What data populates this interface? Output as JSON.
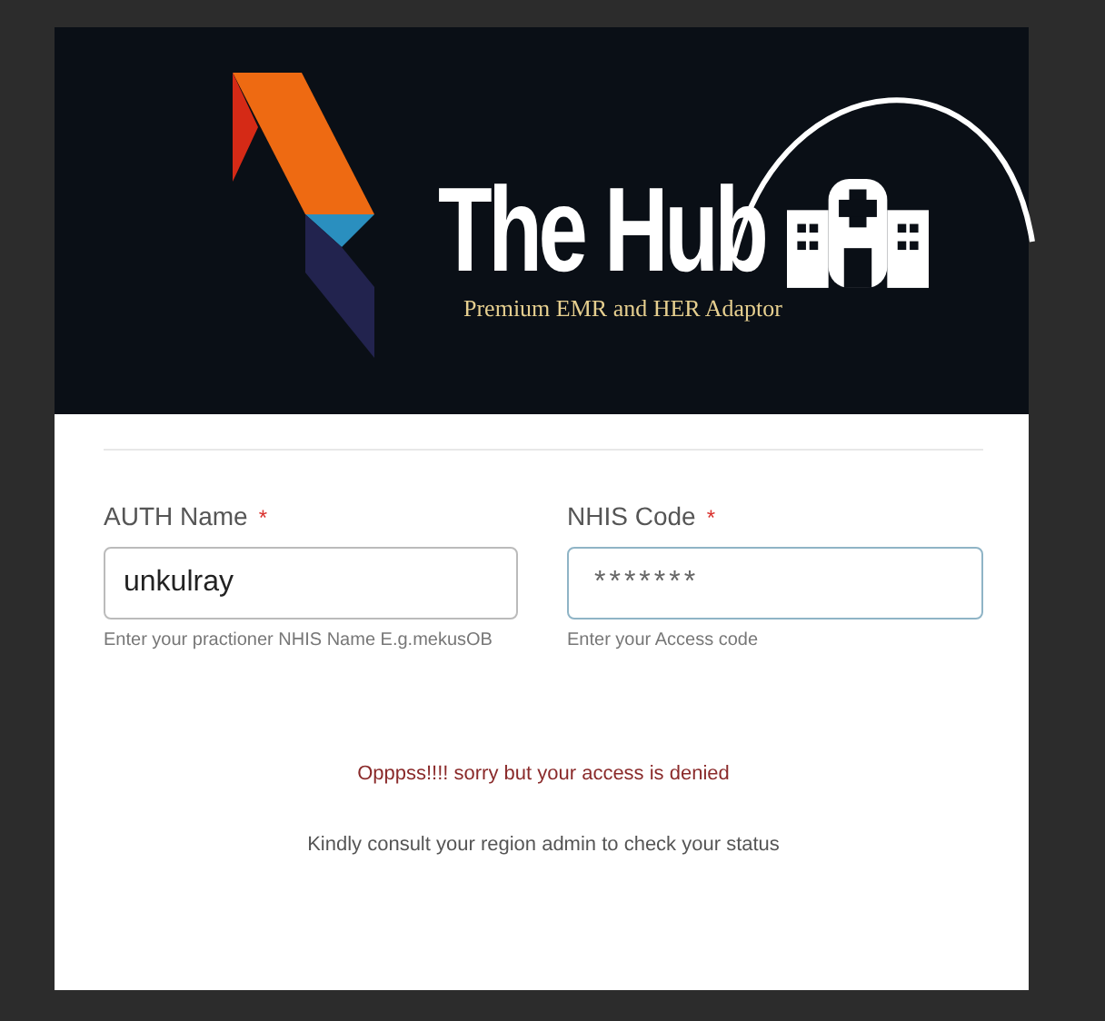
{
  "brand": {
    "title": "The Hub",
    "subtitle": "Premium EMR and HER Adaptor"
  },
  "fields": [
    {
      "label": "AUTH Name",
      "required_mark": "*",
      "value": "unkulray",
      "help": "Enter your practioner NHIS Name E.g.mekusOB",
      "focused": false
    },
    {
      "label": "NHIS Code",
      "required_mark": "*",
      "value": "*******",
      "help": "Enter your Access code",
      "focused": true
    }
  ],
  "error": "Opppss!!!! sorry but your access is denied",
  "note": "Kindly consult your region admin to check your status"
}
